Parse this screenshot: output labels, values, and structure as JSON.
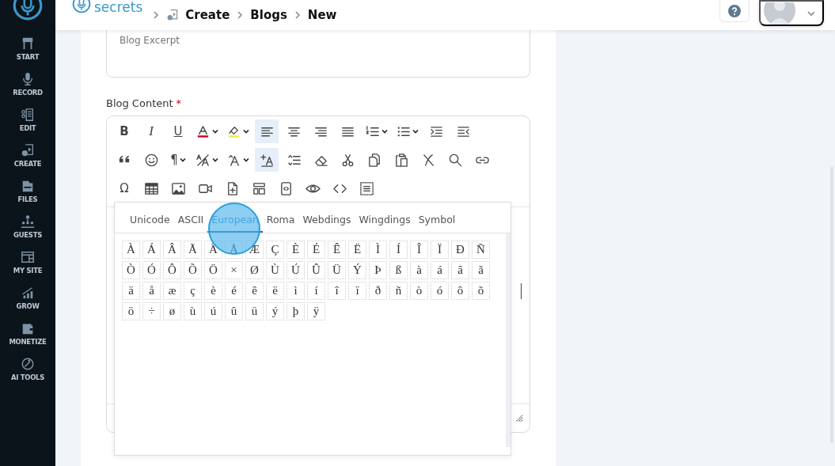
{
  "sidebar": {
    "items": [
      {
        "label": "START"
      },
      {
        "label": "RECORD"
      },
      {
        "label": "EDIT"
      },
      {
        "label": "CREATE"
      },
      {
        "label": "FILES"
      },
      {
        "label": "GUESTS"
      },
      {
        "label": "MY SITE"
      },
      {
        "label": "GROW"
      },
      {
        "label": "MONETIZE"
      },
      {
        "label": "AI TOOLS"
      }
    ]
  },
  "header": {
    "logo_text": "secrets",
    "breadcrumb": [
      {
        "label": "Create"
      },
      {
        "label": "Blogs"
      },
      {
        "label": "New"
      }
    ]
  },
  "form": {
    "excerpt": {
      "placeholder": "Blog Excerpt"
    },
    "content_label": "Blog Content",
    "required_mark": "*"
  },
  "toolbar": {
    "rows": [
      [
        {
          "kind": "bold",
          "label": "B",
          "selected": false,
          "dropdown": false
        },
        {
          "kind": "italic",
          "label": "I",
          "selected": false,
          "dropdown": false
        },
        {
          "kind": "underline",
          "label": "U",
          "selected": false,
          "dropdown": false
        },
        {
          "kind": "text-color",
          "selected": false,
          "dropdown": true
        },
        {
          "kind": "highlight",
          "selected": false,
          "dropdown": true
        },
        {
          "kind": "align-left",
          "selected": true,
          "dropdown": false
        },
        {
          "kind": "align-center",
          "selected": false,
          "dropdown": false
        },
        {
          "kind": "align-right",
          "selected": false,
          "dropdown": false
        },
        {
          "kind": "align-justify",
          "selected": false,
          "dropdown": false
        },
        {
          "kind": "ordered-list",
          "selected": false,
          "dropdown": true
        },
        {
          "kind": "bullet-list",
          "selected": false,
          "dropdown": true
        },
        {
          "kind": "indent",
          "selected": false,
          "dropdown": false
        },
        {
          "kind": "outdent",
          "selected": false,
          "dropdown": false
        }
      ],
      [
        {
          "kind": "quote",
          "selected": false,
          "dropdown": false
        },
        {
          "kind": "emoji",
          "selected": false,
          "dropdown": false
        },
        {
          "kind": "paragraph",
          "label": "¶",
          "selected": false,
          "dropdown": true
        },
        {
          "kind": "font-size",
          "selected": false,
          "dropdown": true
        },
        {
          "kind": "font-family",
          "selected": false,
          "dropdown": true
        },
        {
          "kind": "inline-class",
          "selected": true,
          "dropdown": false
        },
        {
          "kind": "line-height",
          "selected": false,
          "dropdown": false
        },
        {
          "kind": "eraser",
          "selected": false,
          "dropdown": false
        },
        {
          "kind": "cut",
          "selected": false,
          "dropdown": false
        },
        {
          "kind": "copy",
          "selected": false,
          "dropdown": false
        },
        {
          "kind": "paste",
          "selected": false,
          "dropdown": false
        },
        {
          "kind": "clear",
          "selected": false,
          "dropdown": false
        },
        {
          "kind": "search",
          "selected": false,
          "dropdown": false
        },
        {
          "kind": "link",
          "selected": false,
          "dropdown": false
        }
      ],
      [
        {
          "kind": "special-char",
          "label": "Ω",
          "selected": false,
          "dropdown": false
        },
        {
          "kind": "table",
          "selected": false,
          "dropdown": false
        },
        {
          "kind": "image",
          "selected": false,
          "dropdown": false
        },
        {
          "kind": "video",
          "selected": false,
          "dropdown": false
        },
        {
          "kind": "file",
          "selected": false,
          "dropdown": false
        },
        {
          "kind": "layout",
          "selected": false,
          "dropdown": false
        },
        {
          "kind": "code-file",
          "selected": false,
          "dropdown": false
        },
        {
          "kind": "preview",
          "selected": false,
          "dropdown": false
        },
        {
          "kind": "code",
          "selected": false,
          "dropdown": false
        },
        {
          "kind": "select-all",
          "selected": false,
          "dropdown": false
        }
      ]
    ]
  },
  "special_characters": {
    "tabs": [
      {
        "label": "Unicode",
        "selected": false
      },
      {
        "label": "ASCII",
        "selected": false
      },
      {
        "label": "European",
        "selected": true
      },
      {
        "label": "Roma",
        "selected": false
      },
      {
        "label": "Webdings",
        "selected": false
      },
      {
        "label": "Wingdings",
        "selected": false
      },
      {
        "label": "Symbol",
        "selected": false
      }
    ],
    "characters": [
      "À",
      "Á",
      "Â",
      "Ã",
      "Ä",
      "Å",
      "Æ",
      "Ç",
      "È",
      "É",
      "Ê",
      "Ë",
      "Ì",
      "Í",
      "Î",
      "Ï",
      "Ð",
      "Ñ",
      "Ò",
      "Ó",
      "Ô",
      "Õ",
      "Ö",
      "×",
      "Ø",
      "Ù",
      "Ú",
      "Û",
      "Ü",
      "Ý",
      "Þ",
      "ß",
      "à",
      "á",
      "â",
      "ã",
      "ä",
      "å",
      "æ",
      "ç",
      "è",
      "é",
      "ê",
      "ë",
      "ì",
      "í",
      "î",
      "ï",
      "ð",
      "ñ",
      "ò",
      "ó",
      "ô",
      "õ",
      "ö",
      "÷",
      "ø",
      "ù",
      "ú",
      "û",
      "ü",
      "ý",
      "þ",
      "ÿ"
    ]
  }
}
